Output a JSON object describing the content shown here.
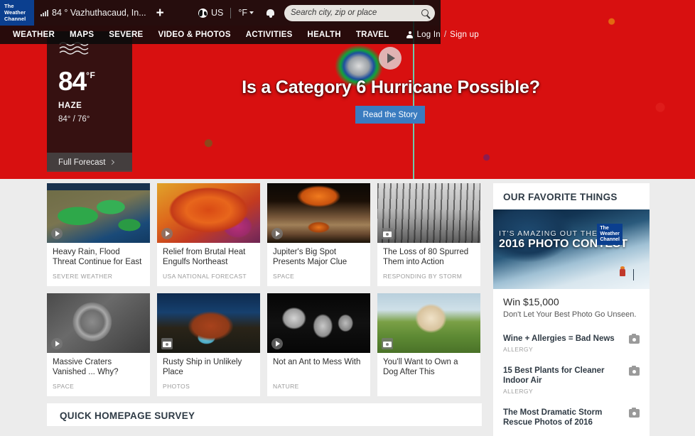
{
  "topbar": {
    "logo_line1": "The",
    "logo_line2": "Weather",
    "logo_line3": "Channel",
    "location": "84 ° Vazhuthacaud, In...",
    "add_label": "+",
    "region": "US",
    "unit": "°F",
    "search_placeholder": "Search city, zip or place"
  },
  "nav": {
    "items": [
      {
        "label": "WEATHER"
      },
      {
        "label": "MAPS"
      },
      {
        "label": "SEVERE"
      },
      {
        "label": "VIDEO & PHOTOS"
      },
      {
        "label": "ACTIVITIES"
      },
      {
        "label": "HEALTH"
      },
      {
        "label": "TRAVEL"
      }
    ],
    "login": "Log In",
    "separator": "/",
    "signup": "Sign up"
  },
  "conditions": {
    "temperature": "84",
    "unit": "°F",
    "phrase": "HAZE",
    "high_low": "84° / 76°",
    "forecast_link": "Full Forecast"
  },
  "hero": {
    "headline": "Is a Category 6 Hurricane Possible?",
    "cta": "Read the Story",
    "accent_color": "#3a7cc0"
  },
  "cards": [
    [
      {
        "title": "Heavy Rain, Flood Threat Continue for East",
        "category": "SEVERE WEATHER",
        "badge": "play",
        "thumb": "t-rain"
      },
      {
        "title": "Relief from Brutal Heat Engulfs Northeast",
        "category": "USA NATIONAL FORECAST",
        "badge": "play",
        "thumb": "t-heat"
      },
      {
        "title": "Jupiter's Big Spot Presents Major Clue",
        "category": "SPACE",
        "badge": "play",
        "thumb": "t-jupiter"
      },
      {
        "title": "The Loss of 80 Spurred Them into Action",
        "category": "RESPONDING BY STORM",
        "badge": "photo",
        "thumb": "t-cactus"
      }
    ],
    [
      {
        "title": "Massive Craters Vanished ... Why?",
        "category": "SPACE",
        "badge": "play",
        "thumb": "t-crater"
      },
      {
        "title": "Rusty Ship in Unlikely Place",
        "category": "PHOTOS",
        "badge": "photo",
        "thumb": "t-ship"
      },
      {
        "title": "Not an Ant to Mess With",
        "category": "NATURE",
        "badge": "play",
        "thumb": "t-ant"
      },
      {
        "title": "You'll Want to Own a Dog After This",
        "category": "",
        "badge": "photo",
        "thumb": "t-dog"
      }
    ]
  ],
  "sidebar": {
    "heading": "OUR FAVORITE THINGS",
    "promo": {
      "tagline": "IT'S AMAZING OUT THERE",
      "maintext": "2016 PHOTO CONTEST",
      "logo_line1": "The",
      "logo_line2": "Weather",
      "logo_line3": "Channel",
      "title": "Win $15,000",
      "subtitle": "Don't Let Your Best Photo Go Unseen."
    },
    "items": [
      {
        "title": "Wine + Allergies = Bad News",
        "category": "ALLERGY"
      },
      {
        "title": "15 Best Plants for Cleaner Indoor Air",
        "category": "ALLERGY"
      },
      {
        "title": "The Most Dramatic Storm Rescue Photos of 2016",
        "category": ""
      }
    ]
  },
  "survey": {
    "title": "QUICK HOMEPAGE SURVEY"
  }
}
